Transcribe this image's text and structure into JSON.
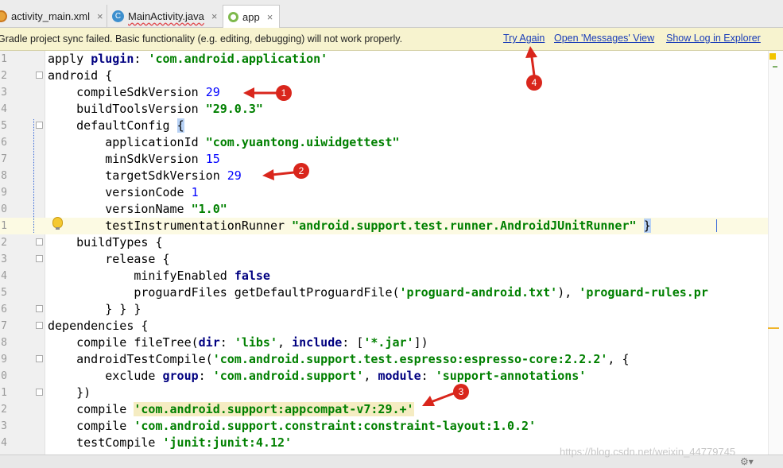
{
  "tabs": [
    {
      "label": "activity_main.xml",
      "close": "×",
      "icon": "xml-file-icon"
    },
    {
      "label": "MainActivity.java",
      "close": "×",
      "icon": "java-class-icon",
      "icon_letter": "C"
    },
    {
      "label": "app",
      "close": "×",
      "icon": "gradle-icon",
      "active": true
    }
  ],
  "banner": {
    "message": "Gradle project sync failed. Basic functionality (e.g. editing, debugging) will not work properly.",
    "try_again": "Try Again",
    "open_messages": "Open 'Messages' View",
    "show_log": "Show Log in Explorer"
  },
  "line_numbers": [
    "1",
    "2",
    "3",
    "4",
    "5",
    "6",
    "7",
    "8",
    "9",
    "0",
    "1",
    "2",
    "3",
    "4",
    "5",
    "6",
    "7",
    "8",
    "9",
    "0",
    "1",
    "2",
    "3",
    "4"
  ],
  "code": {
    "l1_a": "apply ",
    "l1_kw": "plugin",
    "l1_b": ": ",
    "l1_str": "'com.android.application'",
    "l2": "android {",
    "l3_a": "    compileSdkVersion ",
    "l3_num": "29",
    "l4_a": "    buildToolsVersion ",
    "l4_str": "\"29.0.3\"",
    "l5_a": "    defaultConfig ",
    "l5_brace": "{",
    "l6_a": "        applicationId ",
    "l6_str": "\"com.yuantong.uiwidgettest\"",
    "l7_a": "        minSdkVersion ",
    "l7_num": "15",
    "l8_a": "        targetSdkVersion ",
    "l8_num": "29",
    "l9_a": "        versionCode ",
    "l9_num": "1",
    "l10_a": "        versionName ",
    "l10_str": "\"1.0\"",
    "l11_a": "        testInstrumentationRunner ",
    "l11_str": "\"android.support.test.runner.AndroidJUnitRunner\"",
    "l11_b": " ",
    "l11_brace": "}",
    "l12": "    buildTypes {",
    "l13": "        release {",
    "l14_a": "            minifyEnabled ",
    "l14_kw": "false",
    "l15_a": "            proguardFiles getDefaultProguardFile(",
    "l15_str1": "'proguard-android.txt'",
    "l15_b": "), ",
    "l15_str2": "'proguard-rules.pr",
    "l16": "        } } }",
    "l17": "dependencies {",
    "l18_a": "    compile fileTree(",
    "l18_kw1": "dir",
    "l18_b": ": ",
    "l18_str1": "'libs'",
    "l18_c": ", ",
    "l18_kw2": "include",
    "l18_d": ": [",
    "l18_str2": "'*.jar'",
    "l18_e": "])",
    "l19_a": "    androidTestCompile(",
    "l19_str": "'com.android.support.test.espresso:espresso-core:2.2.2'",
    "l19_b": ", {",
    "l20_a": "        exclude ",
    "l20_kw1": "group",
    "l20_b": ": ",
    "l20_str1": "'com.android.support'",
    "l20_c": ", ",
    "l20_kw2": "module",
    "l20_d": ": ",
    "l20_str2": "'support-annotations'",
    "l21": "    })",
    "l22_a": "    compile ",
    "l22_str": "'com.android.support:appcompat-v7:29.+'",
    "l23_a": "    compile ",
    "l23_str": "'com.android.support.constraint:constraint-layout:1.0.2'",
    "l24_a": "    testCompile ",
    "l24_str": "'junit:junit:4.12'"
  },
  "annotations": [
    "1",
    "2",
    "3",
    "4"
  ],
  "watermark": "https://blog.csdn.net/weixin_44779745",
  "colors": {
    "annotation": "#d9261c",
    "link": "#1a3db8",
    "banner_bg": "#f7f3cf",
    "keyword": "#000080",
    "string": "#008000",
    "number": "#0000ff"
  }
}
